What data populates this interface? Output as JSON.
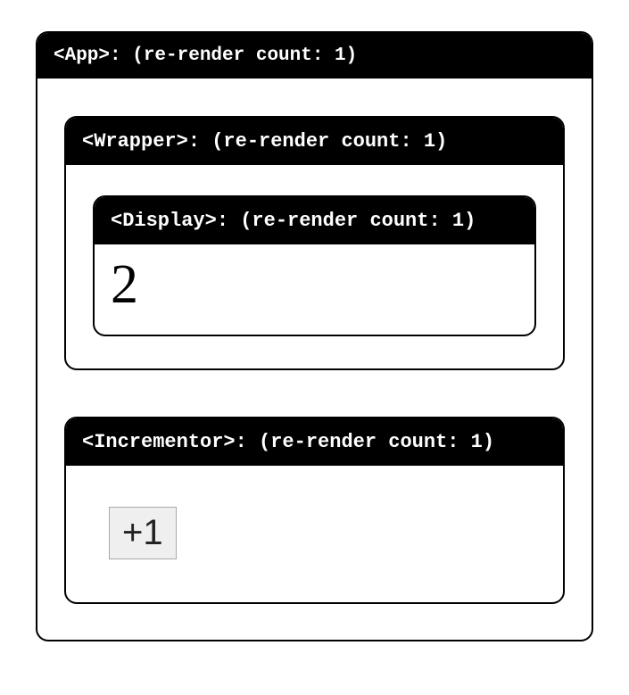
{
  "app": {
    "header": "<App>: (re-render count: 1)"
  },
  "wrapper": {
    "header": "<Wrapper>: (re-render count: 1)"
  },
  "display": {
    "header": "<Display>: (re-render count: 1)",
    "value": "2"
  },
  "incrementor": {
    "header": "<Incrementor>: (re-render count: 1)",
    "button_label": "+1"
  }
}
